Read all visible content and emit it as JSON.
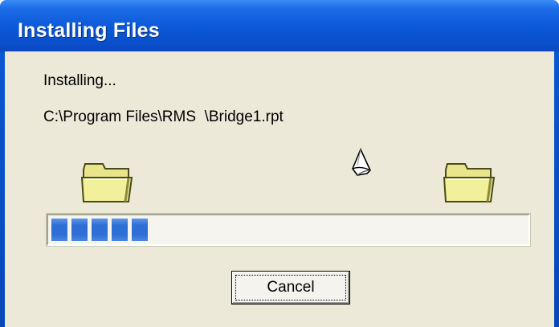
{
  "window": {
    "title": "Installing Files"
  },
  "status": {
    "label": "Installing...",
    "path": "C:\\Program Files\\RMS  \\Bridge1.rpt"
  },
  "animation": {
    "source_icon": "folder-icon",
    "target_icon": "folder-icon",
    "moving_icon": "flying-paper-icon"
  },
  "progress": {
    "fraction": 0.22,
    "color": "#2e6fd6"
  },
  "buttons": {
    "cancel_label": "Cancel"
  }
}
